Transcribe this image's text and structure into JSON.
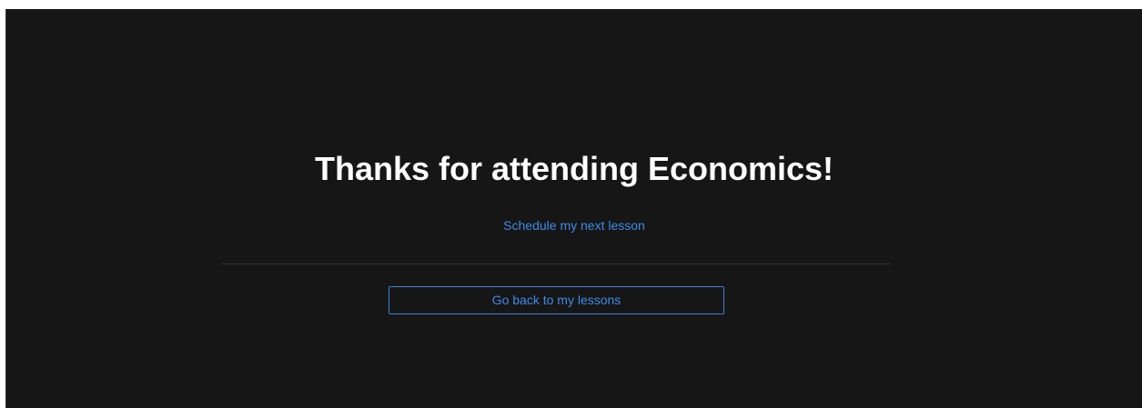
{
  "page": {
    "title": "Thanks for attending Economics!",
    "schedule_link": "Schedule my next lesson",
    "back_button": "Go back to my lessons"
  },
  "colors": {
    "background": "#161616",
    "title": "#ffffff",
    "accent": "#3d8be8",
    "divider": "#333333"
  }
}
